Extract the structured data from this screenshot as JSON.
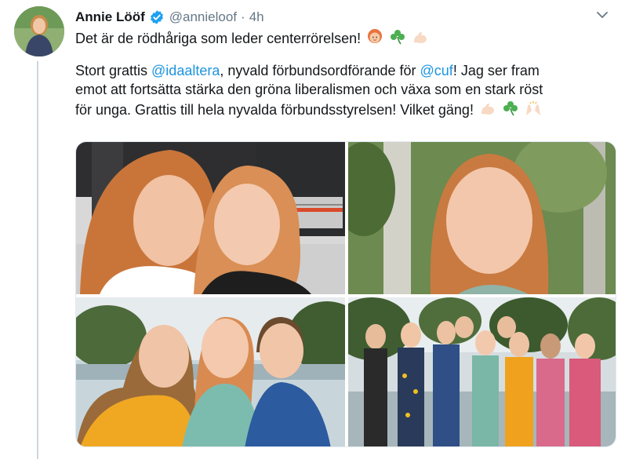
{
  "tweet": {
    "author_name": "Annie Lööf",
    "handle": "@annieloof",
    "separator": "·",
    "time": "4h",
    "line1": "Det är de rödhåriga som leder centerrörelsen!",
    "line2_pre": "Stort grattis ",
    "mention1": "@idaaltera",
    "line2_mid": ", nyvald förbundsordförande för ",
    "mention2": "@cuf",
    "line2_post": "! Jag ser fram",
    "line3": "emot att fortsätta stärka den gröna liberalismen och växa som en stark röst",
    "line4": "för unga. Grattis till hela nyvalda förbundsstyrelsen! Vilket gäng!",
    "emojis_line1": [
      "red-haired-woman",
      "shamrock",
      "flexed-biceps"
    ],
    "emojis_line4": [
      "flexed-biceps",
      "shamrock",
      "raising-hands"
    ]
  },
  "photos": [
    {
      "description_name": "selfie-two-women"
    },
    {
      "description_name": "portrait-redhead"
    },
    {
      "description_name": "three-people"
    },
    {
      "description_name": "group-board"
    }
  ],
  "colors": {
    "link": "#1b95e0",
    "verified": "#1da1f2",
    "muted": "#657786"
  }
}
